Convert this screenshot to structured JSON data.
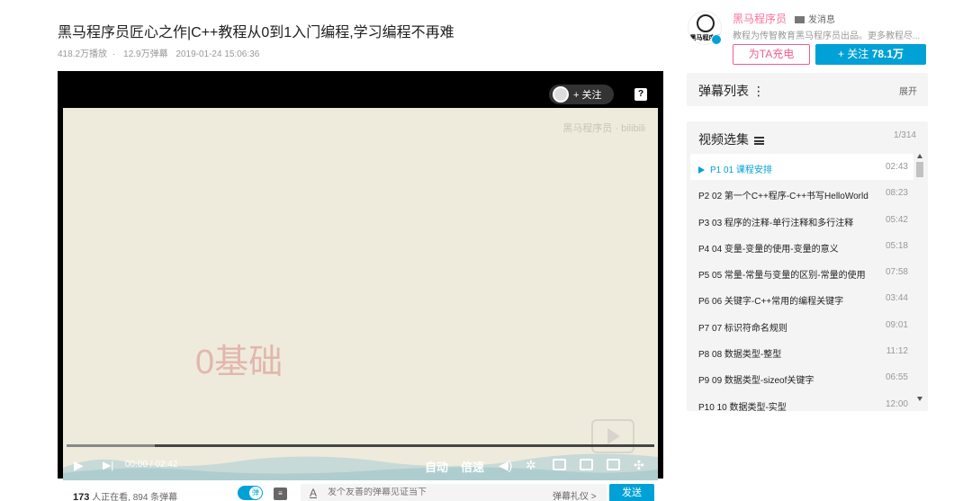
{
  "video": {
    "title": "黑马程序员匠心之作|C++教程从0到1入门编程,学习编程不再难",
    "plays": "418.2万播放",
    "danmaku_count": "12.9万弹幕",
    "date": "2019-01-24 15:06:36"
  },
  "player": {
    "frame_text": "0基础",
    "watermark": "黑马程序员 · bilibili",
    "follow_label": "+ 关注",
    "help_label": "?",
    "time": "00:00 / 02:42",
    "buffered_fraction": 0.15,
    "auto_label": "自动",
    "speed_label": "倍速"
  },
  "bottom": {
    "viewers_count": "173",
    "viewers_suffix": " 人正在看,  894 条弹幕",
    "input_placeholder": "发个友善的弹幕见证当下",
    "gift_label": "弹幕礼仪 >",
    "send_label": "发送",
    "toggle_label": "弹",
    "settings_label": "≡"
  },
  "uploader": {
    "name": "黑马程序员",
    "message_label": "发消息",
    "description": "教程为传智教育黑马程序员出品。更多教程尽...",
    "charge_label": "为TA充电",
    "follow_label": "+  关注",
    "follow_count": "78.1万",
    "avatar_text": "黑马程序员"
  },
  "danmaku_panel": {
    "title": "弹幕列表  ⋮",
    "expand": "展开"
  },
  "episodes": {
    "title": "视频选集",
    "count": "1/314",
    "items": [
      {
        "name": "P1  01 课程安排",
        "dur": "02:43"
      },
      {
        "name": "P2  02 第一个C++程序-C++书写HelloWorld",
        "dur": "08:23"
      },
      {
        "name": "P3  03 程序的注释-单行注释和多行注释",
        "dur": "05:42"
      },
      {
        "name": "P4  04 变量-变量的使用-变量的意义",
        "dur": "05:18"
      },
      {
        "name": "P5  05 常量-常量与变量的区别-常量的使用",
        "dur": "07:58"
      },
      {
        "name": "P6  06 关键字-C++常用的编程关键字",
        "dur": "03:44"
      },
      {
        "name": "P7  07 标识符命名规则",
        "dur": "09:01"
      },
      {
        "name": "P8  08 数据类型-整型",
        "dur": "11:12"
      },
      {
        "name": "P9  09 数据类型-sizeof关键字",
        "dur": "06:55"
      },
      {
        "name": "P10  10 数据类型-实型",
        "dur": "12:00"
      }
    ]
  }
}
